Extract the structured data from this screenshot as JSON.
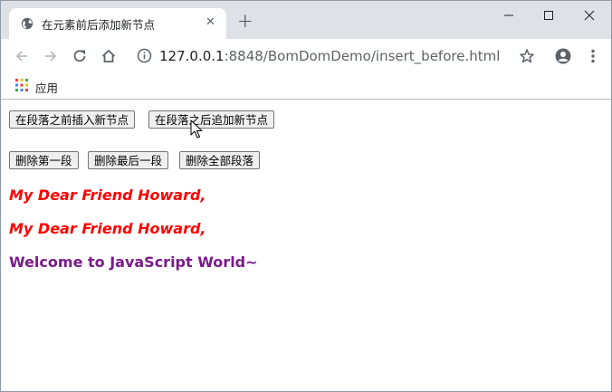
{
  "tab": {
    "title": "在元素前后添加新节点",
    "close_glyph": "✕"
  },
  "newtab_glyph": "+",
  "window_controls": {
    "minimize": "—",
    "maximize": "☐",
    "close": "✕"
  },
  "address": {
    "host": "127.0.0.1",
    "rest": ":8848/BomDomDemo/insert_before.html"
  },
  "bookmarks": {
    "apps_label": "应用"
  },
  "buttons": {
    "insert_before": "在段落之前插入新节点",
    "insert_after": "在段落之后追加新节点",
    "delete_first": "删除第一段",
    "delete_last": "删除最后一段",
    "delete_all": "删除全部段落"
  },
  "paragraphs": [
    "My Dear Friend Howard,",
    "My Dear Friend Howard,",
    "Welcome to JavaScript World~"
  ],
  "colors": {
    "red_text": "#ff0000",
    "purple_text": "#7a1b8a",
    "tabstrip": "#dee1e6"
  },
  "icons": [
    "globe-icon",
    "back-icon",
    "forward-icon",
    "reload-icon",
    "home-icon",
    "info-icon",
    "star-icon",
    "account-icon",
    "menu-icon",
    "apps-icon",
    "cursor-icon"
  ]
}
